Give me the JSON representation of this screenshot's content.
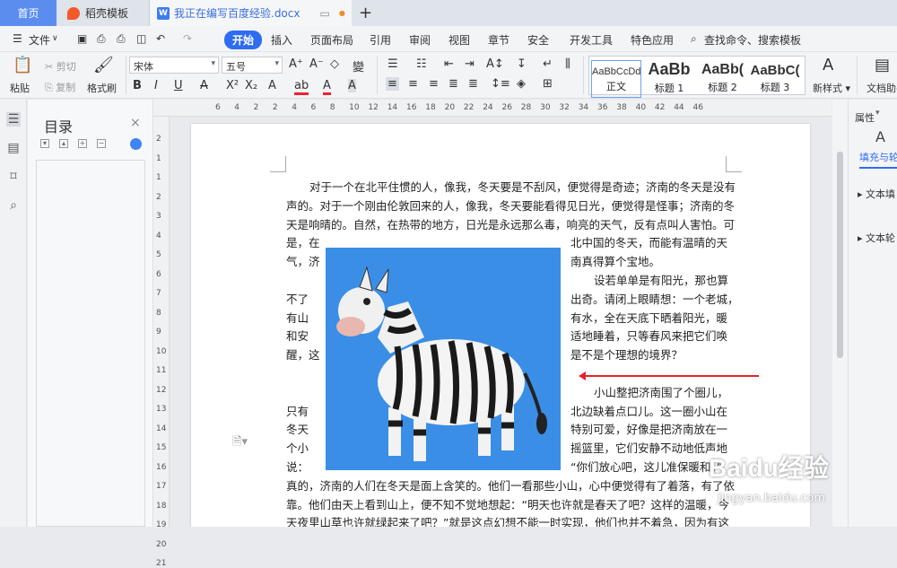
{
  "tabs": {
    "home": "首页",
    "template": "稻壳模板",
    "doc": "我正在编写百度经验.docx",
    "add": "+"
  },
  "menu": {
    "file": "文件",
    "start": "开始",
    "insert": "插入",
    "layout": "页面布局",
    "refs": "引用",
    "review": "审阅",
    "view": "视图",
    "chapter": "章节",
    "security": "安全",
    "dev": "开发工具",
    "special": "特色应用",
    "search": "查找命令、搜索模板"
  },
  "ribbon": {
    "paste": "粘贴",
    "cut": "剪切",
    "copy": "复制",
    "format_painter": "格式刷",
    "font_name": "宋体",
    "font_size": "五号",
    "styles": [
      {
        "sample": "AaBbCcDd",
        "name": "正文"
      },
      {
        "sample": "AaBb",
        "name": "标题 1"
      },
      {
        "sample": "AaBb(",
        "name": "标题 2"
      },
      {
        "sample": "AaBbC(",
        "name": "标题 3"
      }
    ],
    "new_style": "新样式",
    "doc_helper": "文档助手"
  },
  "toc": {
    "title": "目录",
    "close": "×"
  },
  "ruler": {
    "h": [
      "6",
      "4",
      "2",
      "2",
      "4",
      "6",
      "8",
      "10",
      "12",
      "14",
      "16",
      "18",
      "20",
      "22",
      "24",
      "26",
      "28",
      "30",
      "32",
      "34",
      "36",
      "38",
      "40",
      "42",
      "44",
      "46"
    ],
    "v": [
      "2",
      "1",
      "1",
      "2",
      "3",
      "4",
      "5",
      "6",
      "7",
      "8",
      "9",
      "10",
      "11",
      "12",
      "13",
      "14",
      "15",
      "16",
      "17",
      "18",
      "19",
      "20",
      "21"
    ]
  },
  "document": {
    "lines_full_top": [
      "对于一个在北平住惯的人，像我，冬天要是不刮风，便觉得是奇迹；济南的冬天是没有",
      "声的。对于一个刚由伦敦回来的人，像我，冬天要能看得见日光，便觉得是怪事；济南的冬",
      "天是响晴的。自然，在热带的地方，日光是永远那么毒，响亮的天气，反有点叫人害怕。可"
    ],
    "left_col": [
      "是，在",
      "气，济",
      "",
      "不了",
      "有山",
      "和安",
      "醒，这",
      "",
      "",
      "只有",
      "冬天",
      "个小",
      "说："
    ],
    "right_col": [
      "北中国的冬天，而能有温晴的天",
      "南真得算个宝地。",
      "设若单单是有阳光，那也算",
      "出奇。请闭上眼睛想：一个老城，",
      "有水，全在天底下晒着阳光，暖",
      "适地睡着，只等春风来把它们唤",
      "是不是个理想的境界？",
      "",
      "小山整把济南围了个圈儿，",
      "北边缺着点口儿。这一圈小山在",
      "特别可爱，好像是把济南放在一",
      "摇篮里，它们安静不动地低声地",
      "“你们放心吧，这儿准保暖和。”"
    ],
    "lines_full_bottom": [
      "真的，济南的人们在冬天是面上含笑的。他们一看那些小山，心中便觉得有了着落，有了依",
      "靠。他们由天上看到山上，便不知不觉地想起：“明天也许就是春天了吧？这样的温暖，今",
      "天夜里山草也许就绿起来了吧？”就是这点幻想不能一时实现，他们也并不着急，因为有这"
    ]
  },
  "right_panel": {
    "title": "属性",
    "fill": "填充与轮",
    "text_fill": "文本填",
    "text_outline": "文本轮"
  },
  "watermark": {
    "main": "Baidu经验",
    "sub": "jingyan.baidu.com"
  },
  "icons": [
    "menu-icon",
    "save-icon",
    "print-icon",
    "undo-icon",
    "redo-icon",
    "search-icon",
    "paste-icon",
    "bold-icon",
    "italic-icon",
    "underline-icon",
    "toc-icon",
    "zebra-image"
  ]
}
